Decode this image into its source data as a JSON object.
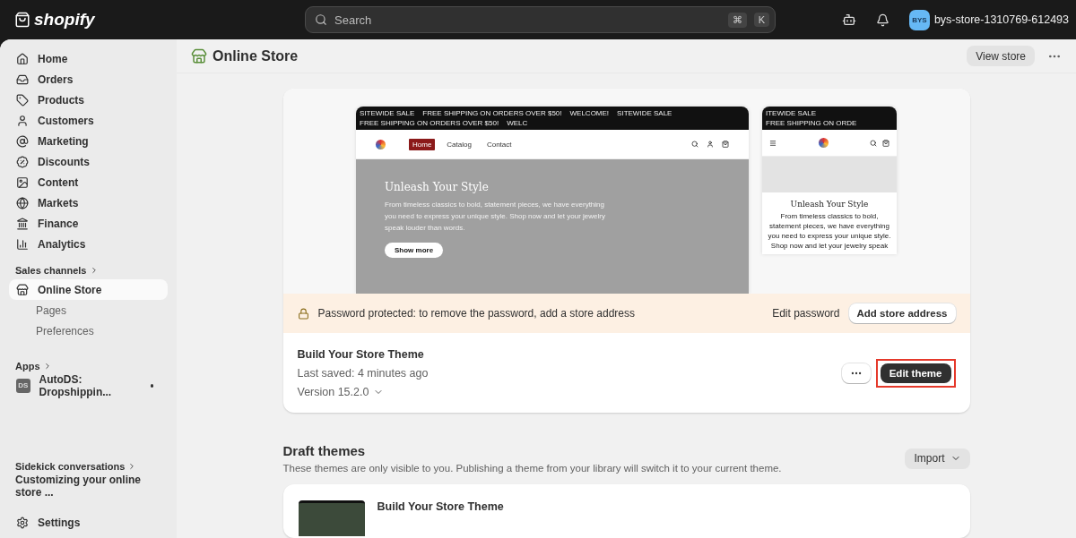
{
  "topbar": {
    "brand": "shopify",
    "search": {
      "placeholder": "Search",
      "keys": [
        "⌘",
        "K"
      ]
    },
    "store": {
      "initials": "BYS",
      "name": "bys-store-1310769-612493"
    }
  },
  "sidebar": {
    "items": [
      {
        "kind": "home",
        "label": "Home",
        "selected": false
      },
      {
        "kind": "orders",
        "label": "Orders",
        "selected": false
      },
      {
        "kind": "products",
        "label": "Products",
        "selected": false
      },
      {
        "kind": "customers",
        "label": "Customers",
        "selected": false
      },
      {
        "kind": "marketing",
        "label": "Marketing",
        "selected": false
      },
      {
        "kind": "discounts",
        "label": "Discounts",
        "selected": false
      },
      {
        "kind": "content",
        "label": "Content",
        "selected": false
      },
      {
        "kind": "markets",
        "label": "Markets",
        "selected": false
      },
      {
        "kind": "finance",
        "label": "Finance",
        "selected": false
      },
      {
        "kind": "analytics",
        "label": "Analytics",
        "selected": false
      }
    ],
    "sales_channels": {
      "heading": "Sales channels",
      "items": [
        {
          "label": "Online Store",
          "selected": true,
          "children": [
            {
              "label": "Pages",
              "selected": false
            },
            {
              "label": "Preferences",
              "selected": false
            }
          ]
        }
      ]
    },
    "apps": {
      "heading": "Apps",
      "items": [
        {
          "icon_text": "DS",
          "label": "AutoDS: Dropshippin...",
          "dot": true
        }
      ]
    },
    "sidekick": {
      "heading": "Sidekick conversations",
      "items": [
        "Customizing your online store ..."
      ]
    },
    "settings": "Settings"
  },
  "page": {
    "title": "Online Store",
    "view_store": "View store"
  },
  "current_theme": {
    "desktop_preview": {
      "marquee": [
        "SITEWIDE SALE",
        "FREE SHIPPING ON ORDERS OVER $50!",
        "WELCOME!",
        "SITEWIDE SALE",
        "FREE SHIPPING ON ORDERS OVER $50!",
        "WELC"
      ],
      "nav": [
        {
          "label": "Home",
          "selected": true
        },
        {
          "label": "Catalog",
          "selected": false
        },
        {
          "label": "Contact",
          "selected": false
        }
      ],
      "hero_title": "Unleash Your Style",
      "hero_text": "From timeless classics to bold, statement pieces, we have everything you need to express your unique style. Shop now and let your jewelry speak louder than words.",
      "hero_button": "Show more"
    },
    "mobile_preview": {
      "marquee": [
        "ITEWIDE SALE",
        "FREE SHIPPING ON ORDE"
      ],
      "hero_title": "Unleash Your Style",
      "hero_text": "From timeless classics to bold, statement pieces, we have everything you need to express your unique style. Shop now and let your jewelry speak"
    },
    "banner": {
      "text": "Password protected: to remove the password, add a store address",
      "link": "Edit password",
      "button": "Add store address"
    },
    "name": "Build Your Store Theme",
    "last_saved": "Last saved: 4 minutes ago",
    "version": "Version 15.2.0",
    "edit_button": {
      "label": "Edit theme",
      "highlighted": true
    }
  },
  "draft_themes": {
    "title": "Draft themes",
    "description": "These themes are only visible to you. Publishing a theme from your library will switch it to your current theme.",
    "import": "Import",
    "items": [
      {
        "name": "Build Your Store Theme"
      }
    ]
  }
}
